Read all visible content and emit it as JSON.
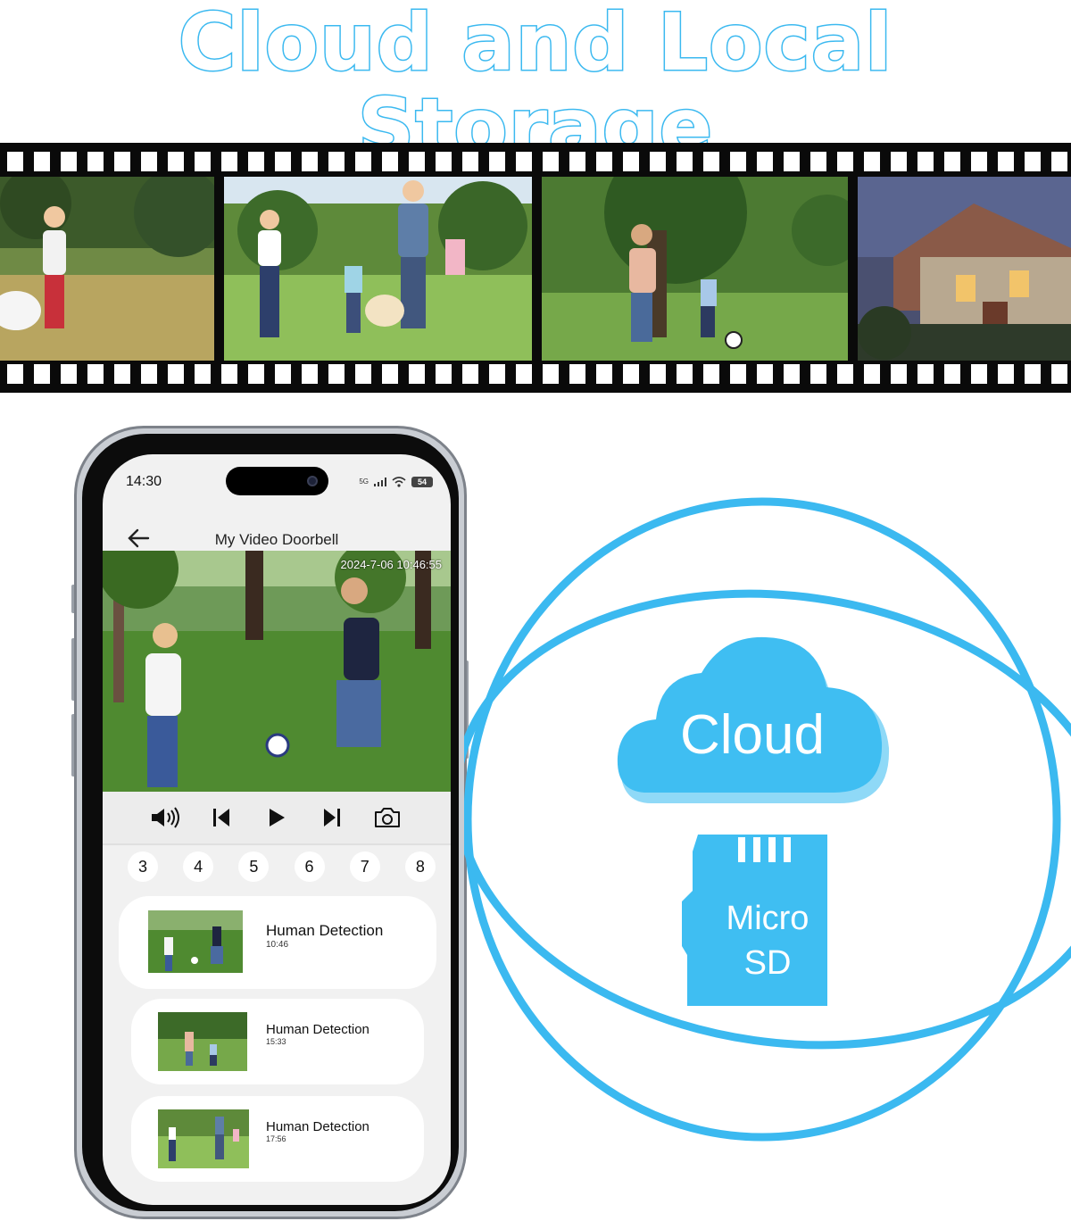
{
  "headline": "Cloud and Local Storage",
  "phone": {
    "status_time": "14:30",
    "network": "5G",
    "battery": "54",
    "app_title": "My Video Doorbell",
    "video_timestamp": "2024-7-06 10:46:55",
    "controls": [
      "speaker-icon",
      "previous-icon",
      "play-icon",
      "next-icon",
      "camera-icon"
    ],
    "pages": [
      "3",
      "4",
      "5",
      "6",
      "7",
      "8"
    ],
    "events": [
      {
        "title": "Human Detection",
        "time": "10:46"
      },
      {
        "title": "Human Detection",
        "time": "15:33"
      },
      {
        "title": "Human Detection",
        "time": "17:56"
      }
    ]
  },
  "graphic": {
    "cloud_label": "Cloud",
    "sd_label_line1": "Micro",
    "sd_label_line2": "SD"
  },
  "colors": {
    "accent": "#3bb9f0",
    "cloud_fill": "#3fbef2",
    "cloud_shadow": "#8fd9f7",
    "film": "#0a0a0a"
  }
}
